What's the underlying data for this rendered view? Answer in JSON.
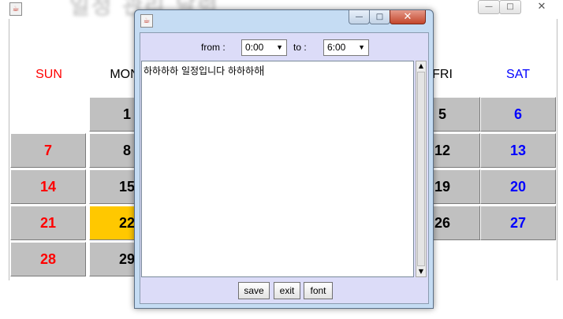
{
  "background_window": {
    "title": "일정 관리 달력",
    "title_icon": "java-icon",
    "controls": {
      "minimize": "—",
      "maximize": "□",
      "close": "✕"
    },
    "weekday_headers": [
      {
        "label": "SUN",
        "color": "#ff0000"
      },
      {
        "label": "MON",
        "color": "#000000"
      },
      {
        "label": "FRI",
        "color": "#000000"
      },
      {
        "label": "SAT",
        "color": "#0000ff"
      }
    ],
    "today": "22",
    "today_color": "#ffc800",
    "days": {
      "d1": "1",
      "d5": "5",
      "d6": "6",
      "d7": "7",
      "d8": "8",
      "d12": "12",
      "d13": "13",
      "d14": "14",
      "d15": "15",
      "d19": "19",
      "d20": "20",
      "d21": "21",
      "d22": "22",
      "d26": "26",
      "d27": "27",
      "d28": "28",
      "d29": "29"
    }
  },
  "dialog": {
    "title_icon": "java-icon",
    "controls": {
      "minimize": "—",
      "maximize": "□",
      "close": "✕"
    },
    "time": {
      "from_label": "from :",
      "from_value": "0:00",
      "to_label": "to :",
      "to_value": "6:00"
    },
    "memo_text": "하하하하 일정입니다 하하하하",
    "scrollbar": {
      "up": "▲",
      "down": "▼"
    },
    "buttons": {
      "save": "save",
      "exit": "exit",
      "font": "font"
    }
  }
}
